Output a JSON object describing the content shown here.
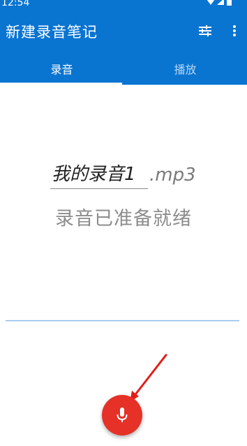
{
  "status_bar": {
    "time": "12:54"
  },
  "toolbar": {
    "title": "新建录音笔记",
    "tune_icon": "tune-icon",
    "more_icon": "more-vert-icon"
  },
  "tabs": [
    {
      "label": "录音",
      "active": true
    },
    {
      "label": "播放",
      "active": false
    }
  ],
  "recorder": {
    "filename_value": "我的录音1",
    "filename_extension": ".mp3",
    "status": "录音已准备就绪",
    "record_button_icon": "microphone-icon"
  },
  "colors": {
    "primary": "#0a74d1",
    "record_button": "#e53127",
    "annotation_arrow": "#e0201a"
  }
}
